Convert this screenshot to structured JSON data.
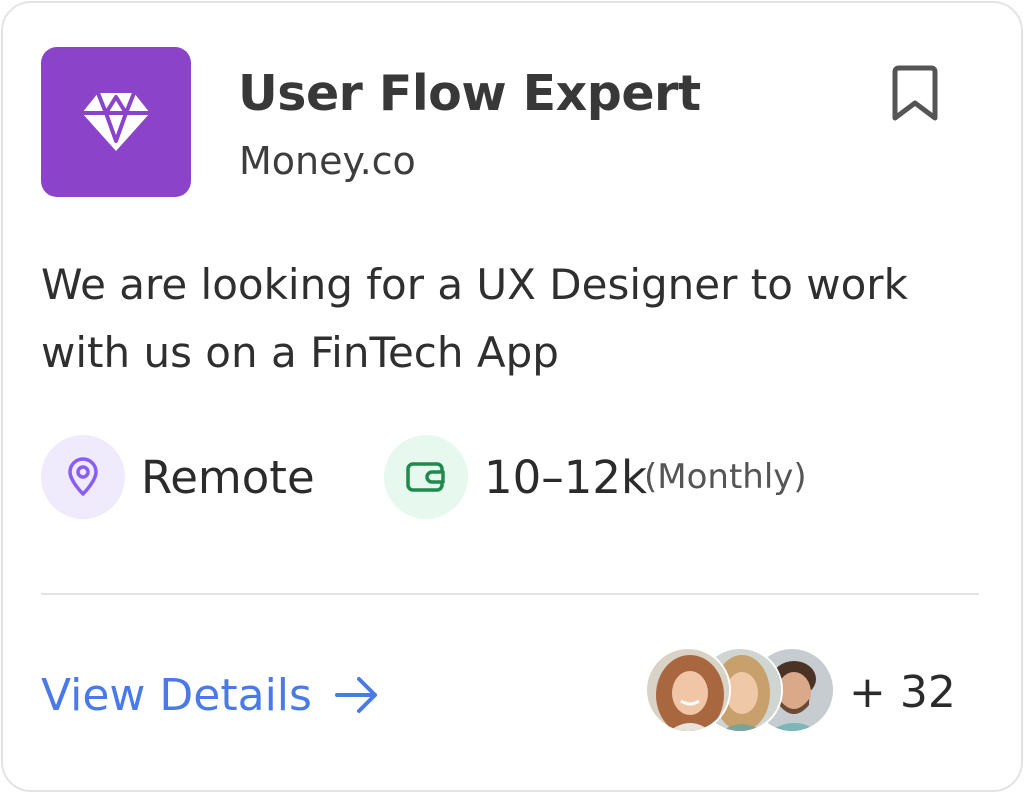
{
  "job": {
    "title": "User Flow Expert",
    "company": "Money.co",
    "logo_icon": "diamond-icon",
    "description": "We are looking for a UX Designer to work with us on a FinTech App",
    "bookmark_icon": "bookmark-icon"
  },
  "meta": {
    "location": {
      "icon": "location-pin-icon",
      "label": "Remote"
    },
    "salary": {
      "icon": "wallet-icon",
      "amount": "10–12k",
      "period": "(Monthly)"
    }
  },
  "footer": {
    "view_details_label": "View Details",
    "arrow_icon": "arrow-right-icon",
    "applicants_more": "+ 32"
  },
  "colors": {
    "logo_bg": "#8a43c9",
    "link": "#4a7ae8",
    "location_chip": "#efeafc",
    "location_icon": "#8b5cf6",
    "salary_chip": "#e7f8ee",
    "salary_icon": "#1f8a4c"
  }
}
